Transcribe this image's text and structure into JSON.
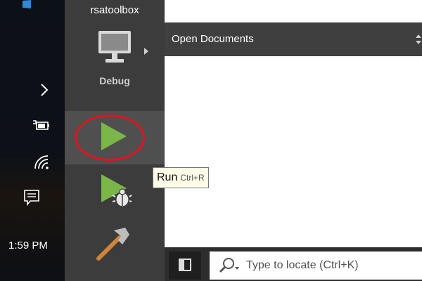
{
  "taskbar": {
    "clock": "1:59 PM",
    "icons": [
      "windows-logo-icon",
      "chevron-right-icon",
      "battery-plug-icon",
      "wifi-icon",
      "notification-icon"
    ]
  },
  "sidebar": {
    "app_title": "rsatoolbox",
    "kit_label": "Debug",
    "run_tooltip": "Run",
    "run_shortcut": "Ctrl+R",
    "icons": [
      "monitor-icon",
      "play-icon",
      "debug-run-icon",
      "hammer-icon"
    ]
  },
  "documents": {
    "title": "Open Documents"
  },
  "locate": {
    "placeholder": "Type to locate (Ctrl+K)"
  },
  "colors": {
    "run_green": "#7ab648",
    "highlight_red": "#e2141d",
    "panel": "#3c3c3c",
    "tooltip_bg": "#fffde7"
  }
}
